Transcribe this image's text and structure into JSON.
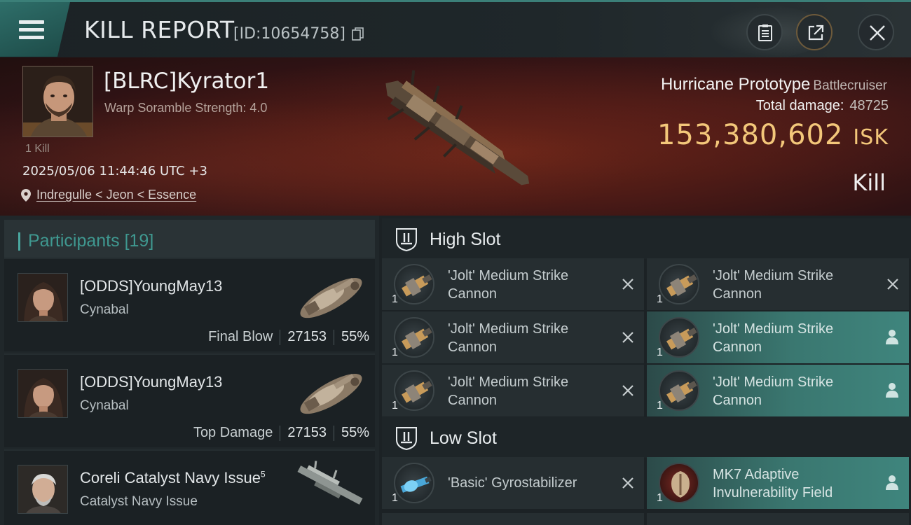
{
  "header": {
    "title": "KILL REPORT",
    "report_id": "[ID:10654758]",
    "icons": [
      "menu-icon",
      "copy-icon",
      "clipboard-icon",
      "share-icon",
      "close-icon"
    ]
  },
  "victim": {
    "name": "[BLRC]Kyrator1",
    "stat": "Warp Soramble Strength: 4.0",
    "kill_tag": "1 Kill",
    "datetime": "2025/05/06 11:44:46 UTC +3",
    "location": "Indregulle < Jeon < Essence"
  },
  "ship": {
    "name": "Hurricane Prototype",
    "class": "Battlecruiser",
    "total_damage_label": "Total damage:",
    "total_damage": "48725",
    "isk_value": "153,380,602",
    "isk_unit": "ISK",
    "result": "Kill"
  },
  "participants": {
    "label": "Participants",
    "count": "[19]",
    "items": [
      {
        "name": "[ODDS]YoungMay13",
        "ship": "Cynabal",
        "role": "Final Blow",
        "damage": "27153",
        "percent": "55%"
      },
      {
        "name": "[ODDS]YoungMay13",
        "ship": "Cynabal",
        "role": "Top Damage",
        "damage": "27153",
        "percent": "55%"
      },
      {
        "name": "Coreli Catalyst Navy Issue",
        "superscript": "5",
        "ship": "Catalyst Navy Issue"
      }
    ]
  },
  "fitting": {
    "high_slot_label": "High Slot",
    "low_slot_label": "Low Slot",
    "high_slots": [
      {
        "name": "'Jolt' Medium Strike Cannon",
        "qty": "1",
        "status": "destroyed"
      },
      {
        "name": "'Jolt' Medium Strike Cannon",
        "qty": "1",
        "status": "destroyed"
      },
      {
        "name": "'Jolt' Medium Strike Cannon",
        "qty": "1",
        "status": "destroyed"
      },
      {
        "name": "'Jolt' Medium Strike Cannon",
        "qty": "1",
        "status": "dropped"
      },
      {
        "name": "'Jolt' Medium Strike Cannon",
        "qty": "1",
        "status": "destroyed"
      },
      {
        "name": "'Jolt' Medium Strike Cannon",
        "qty": "1",
        "status": "dropped"
      }
    ],
    "low_slots": [
      {
        "name": "'Basic' Gyrostabilizer",
        "qty": "1",
        "status": "destroyed"
      },
      {
        "name": "MK7 Adaptive Invulnerability Field",
        "qty": "1",
        "status": "dropped"
      }
    ]
  },
  "colors": {
    "accent_teal": "#3f857d",
    "isk_gold": "#f3c77a",
    "hero_red": "#4e1b16"
  }
}
